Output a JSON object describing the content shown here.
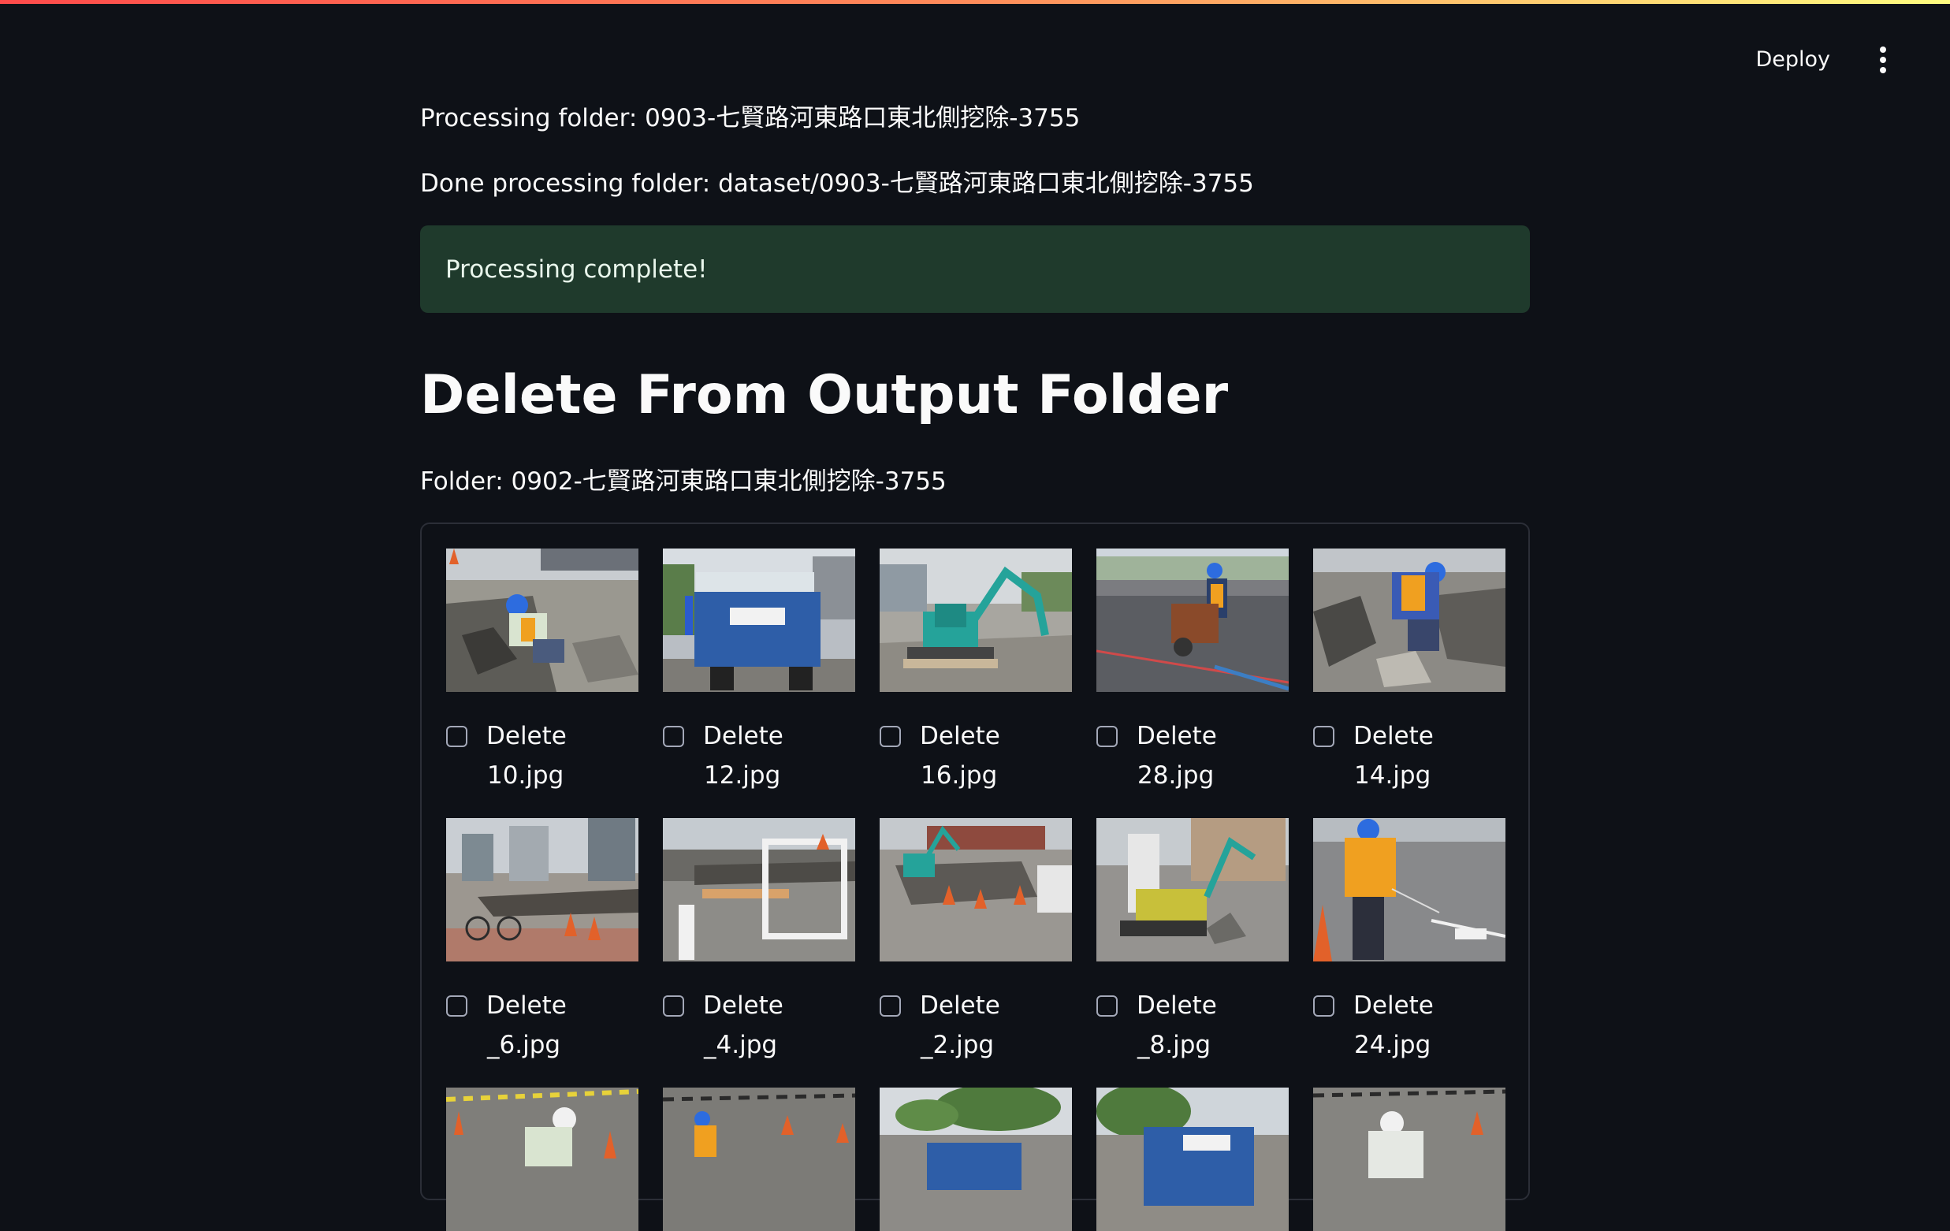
{
  "app": {
    "deploy_label": "Deploy",
    "menu_icon": "more-vertical-icon"
  },
  "status": {
    "processing_line": "Processing folder: 0903-七賢路河東路口東北側挖除-3755",
    "done_line": "Done processing folder: dataset/0903-七賢路河東路口東北側挖除-3755",
    "success_message": "Processing complete!"
  },
  "section": {
    "title": "Delete From Output Folder",
    "folder_label": "Folder: 0902-七賢路河東路口東北側挖除-3755"
  },
  "gallery": {
    "delete_label": "Delete",
    "items": [
      {
        "file": "10.jpg",
        "checked": false,
        "scene": "worker-kneeling-rubble"
      },
      {
        "file": "12.jpg",
        "checked": false,
        "scene": "blue-dump-truck"
      },
      {
        "file": "16.jpg",
        "checked": false,
        "scene": "teal-mini-excavator"
      },
      {
        "file": "28.jpg",
        "checked": false,
        "scene": "worker-cutting-road"
      },
      {
        "file": "14.jpg",
        "checked": false,
        "scene": "worker-lifting-rubble"
      },
      {
        "file": "_6.jpg",
        "checked": false,
        "scene": "sidewalk-rubble-cones"
      },
      {
        "file": "_4.jpg",
        "checked": false,
        "scene": "barrier-on-asphalt"
      },
      {
        "file": "_2.jpg",
        "checked": false,
        "scene": "excavator-cones"
      },
      {
        "file": "_8.jpg",
        "checked": false,
        "scene": "mini-excavator-street"
      },
      {
        "file": "24.jpg",
        "checked": false,
        "scene": "worker-with-saw"
      },
      {
        "file": "",
        "checked": false,
        "scene": "worker-crouching-white-helmet"
      },
      {
        "file": "",
        "checked": false,
        "scene": "workers-street"
      },
      {
        "file": "",
        "checked": false,
        "scene": "trees-truck"
      },
      {
        "file": "",
        "checked": false,
        "scene": "blue-truck-trees"
      },
      {
        "file": "",
        "checked": false,
        "scene": "worker-white-helmet"
      }
    ]
  }
}
